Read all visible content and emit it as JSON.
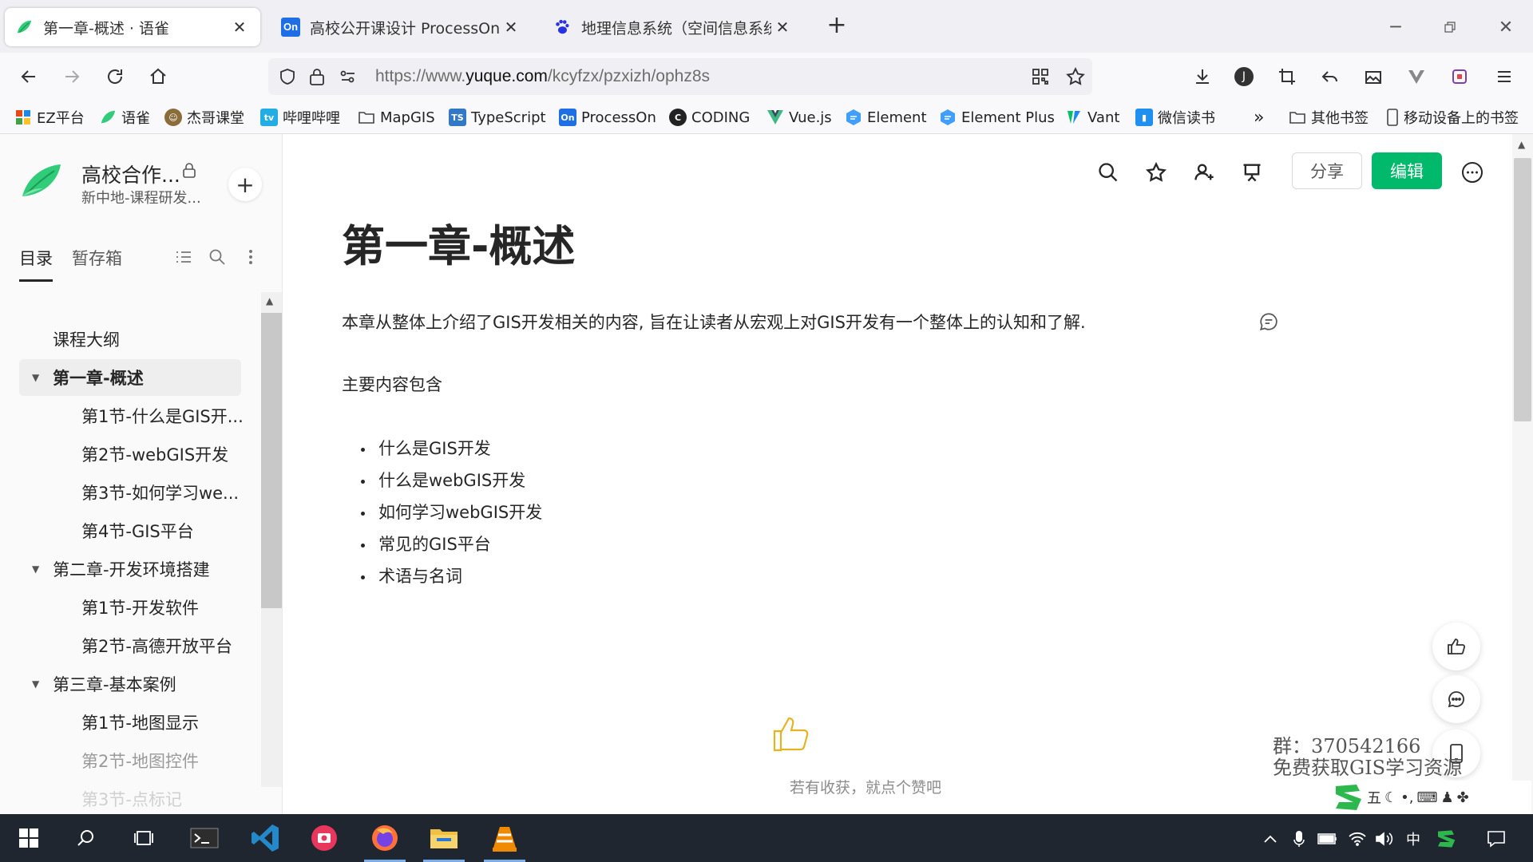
{
  "browser": {
    "tabs": [
      {
        "title": "第一章-概述 · 语雀",
        "active": true,
        "favicon": "yuque-icon"
      },
      {
        "title": "高校公开课设计 ProcessOn Mi",
        "active": false,
        "favicon": "processon-icon"
      },
      {
        "title": "地理信息系统（空间信息系统）",
        "active": false,
        "favicon": "baidu-paw-icon"
      }
    ],
    "url_prefix": "https://www.",
    "url_domain": "yuque.com",
    "url_path": "/kcyfzx/pzxizh/ophz8s",
    "bookmarks": [
      {
        "label": "EZ平台",
        "icon": "ez-icon",
        "color": "#e64a19"
      },
      {
        "label": "语雀",
        "icon": "yuque-icon",
        "color": "#31cc79"
      },
      {
        "label": "杰哥课堂",
        "icon": "avatar-icon",
        "color": "#8a6d3b"
      },
      {
        "label": "哔哩哔哩",
        "icon": "bilibili-icon",
        "color": "#23ade5"
      },
      {
        "label": "MapGIS",
        "icon": "folder-icon",
        "color": "#555555"
      },
      {
        "label": "TypeScript",
        "icon": "ts-icon",
        "color": "#3178c6"
      },
      {
        "label": "ProcessOn",
        "icon": "processon-icon",
        "color": "#1e6fe5"
      },
      {
        "label": "CODING",
        "icon": "coding-icon",
        "color": "#222222"
      },
      {
        "label": "Vue.js",
        "icon": "vue-icon",
        "color": "#41b883"
      },
      {
        "label": "Element",
        "icon": "element-icon",
        "color": "#409eff"
      },
      {
        "label": "Element Plus",
        "icon": "element-icon",
        "color": "#409eff"
      },
      {
        "label": "Vant",
        "icon": "vant-icon",
        "color": "#07c160"
      },
      {
        "label": "微信读书",
        "icon": "weread-icon",
        "color": "#1f8ff0"
      }
    ],
    "other_bookmarks": "其他书签",
    "mobile_bookmarks": "移动设备上的书签"
  },
  "sidebar": {
    "kb_title": "高校合作...",
    "kb_subtitle": "新中地-课程研发...",
    "tabs": {
      "toc": "目录",
      "drafts": "暂存箱"
    },
    "toc": [
      {
        "label": "课程大纲",
        "level": 1,
        "caret": false
      },
      {
        "label": "第一章-概述",
        "level": 1,
        "caret": true,
        "selected": true
      },
      {
        "label": "第1节-什么是GIS开...",
        "level": 2
      },
      {
        "label": "第2节-webGIS开发",
        "level": 2
      },
      {
        "label": "第3节-如何学习we...",
        "level": 2
      },
      {
        "label": "第4节-GIS平台",
        "level": 2
      },
      {
        "label": "第二章-开发环境搭建",
        "level": 1,
        "caret": true
      },
      {
        "label": "第1节-开发软件",
        "level": 2
      },
      {
        "label": "第2节-高德开放平台",
        "level": 2
      },
      {
        "label": "第三章-基本案例",
        "level": 1,
        "caret": true
      },
      {
        "label": "第1节-地图显示",
        "level": 2
      },
      {
        "label": "第2节-地图控件",
        "level": 2
      },
      {
        "label": "第3节-点标记",
        "level": 2
      }
    ]
  },
  "toolbar": {
    "share_label": "分享",
    "edit_label": "编辑",
    "edit_color": "#00b96b"
  },
  "doc": {
    "title": "第一章-概述",
    "intro": "本章从整体上介绍了GIS开发相关的内容, 旨在让读者从宏观上对GIS开发有一个整体上的认知和了解.",
    "subheading": "主要内容包含",
    "bullets": [
      "什么是GIS开发",
      "什么是webGIS开发",
      "如何学习webGIS开发",
      "常见的GIS平台",
      "术语与名词"
    ],
    "like_prompt": "若有收获，就点个赞吧"
  },
  "watermark": {
    "line1": "群：370542166",
    "line2": "免费获取GIS学习资源"
  },
  "ime": {
    "mode": "五",
    "lang": "中"
  }
}
